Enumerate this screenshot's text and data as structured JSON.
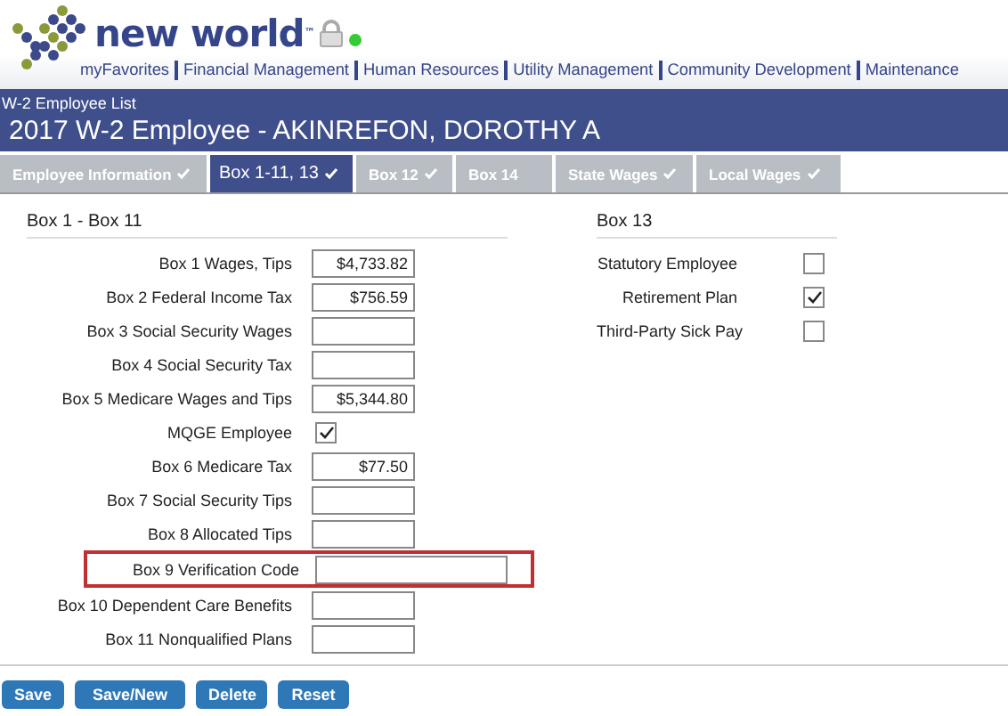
{
  "logo": {
    "text": "new world",
    "trademark": "™"
  },
  "nav": [
    "myFavorites",
    "Financial Management",
    "Human Resources",
    "Utility Management",
    "Community Development",
    "Maintenance"
  ],
  "breadcrumb": "W-2 Employee List",
  "title": "2017 W-2 Employee - AKINREFON, DOROTHY A",
  "tabs": [
    {
      "label": "Employee Information",
      "complete": true,
      "selected": false
    },
    {
      "label": "Box 1-11, 13",
      "complete": true,
      "selected": true
    },
    {
      "label": "Box 12",
      "complete": true,
      "selected": false
    },
    {
      "label": "Box 14",
      "complete": false,
      "selected": false
    },
    {
      "label": "State Wages",
      "complete": true,
      "selected": false
    },
    {
      "label": "Local Wages",
      "complete": true,
      "selected": false
    }
  ],
  "left_section": {
    "heading": "Box 1 - Box 11",
    "rows": [
      {
        "label": "Box 1 Wages, Tips",
        "kind": "text",
        "value": "$4,733.82",
        "highlighted": false
      },
      {
        "label": "Box 2 Federal Income Tax",
        "kind": "text",
        "value": "$756.59",
        "highlighted": false
      },
      {
        "label": "Box 3 Social Security Wages",
        "kind": "text",
        "highlighted": false
      },
      {
        "label": "Box 4 Social Security Tax",
        "kind": "text",
        "highlighted": false
      },
      {
        "label": "Box 5 Medicare Wages and Tips",
        "kind": "text",
        "value": "$5,344.80",
        "highlighted": false
      },
      {
        "label": "MQGE Employee",
        "kind": "checkbox",
        "checked": true,
        "highlighted": false
      },
      {
        "label": "Box 6 Medicare Tax",
        "kind": "text",
        "value": "$77.50",
        "highlighted": false
      },
      {
        "label": "Box 7 Social Security Tips",
        "kind": "text",
        "highlighted": false
      },
      {
        "label": "Box 8 Allocated Tips",
        "kind": "text",
        "highlighted": false
      },
      {
        "label": "Box 9 Verification Code",
        "kind": "text",
        "highlighted": true
      },
      {
        "label": "Box 10 Dependent Care Benefits",
        "kind": "text",
        "highlighted": false
      },
      {
        "label": "Box 11 Nonqualified Plans",
        "kind": "text",
        "highlighted": false
      }
    ]
  },
  "right_section": {
    "heading": "Box 13",
    "rows": [
      {
        "label": "Statutory Employee",
        "checked": false
      },
      {
        "label": "Retirement Plan",
        "checked": true
      },
      {
        "label": "Third-Party Sick Pay",
        "checked": false
      }
    ]
  },
  "buttons": [
    "Save",
    "Save/New",
    "Delete",
    "Reset"
  ]
}
